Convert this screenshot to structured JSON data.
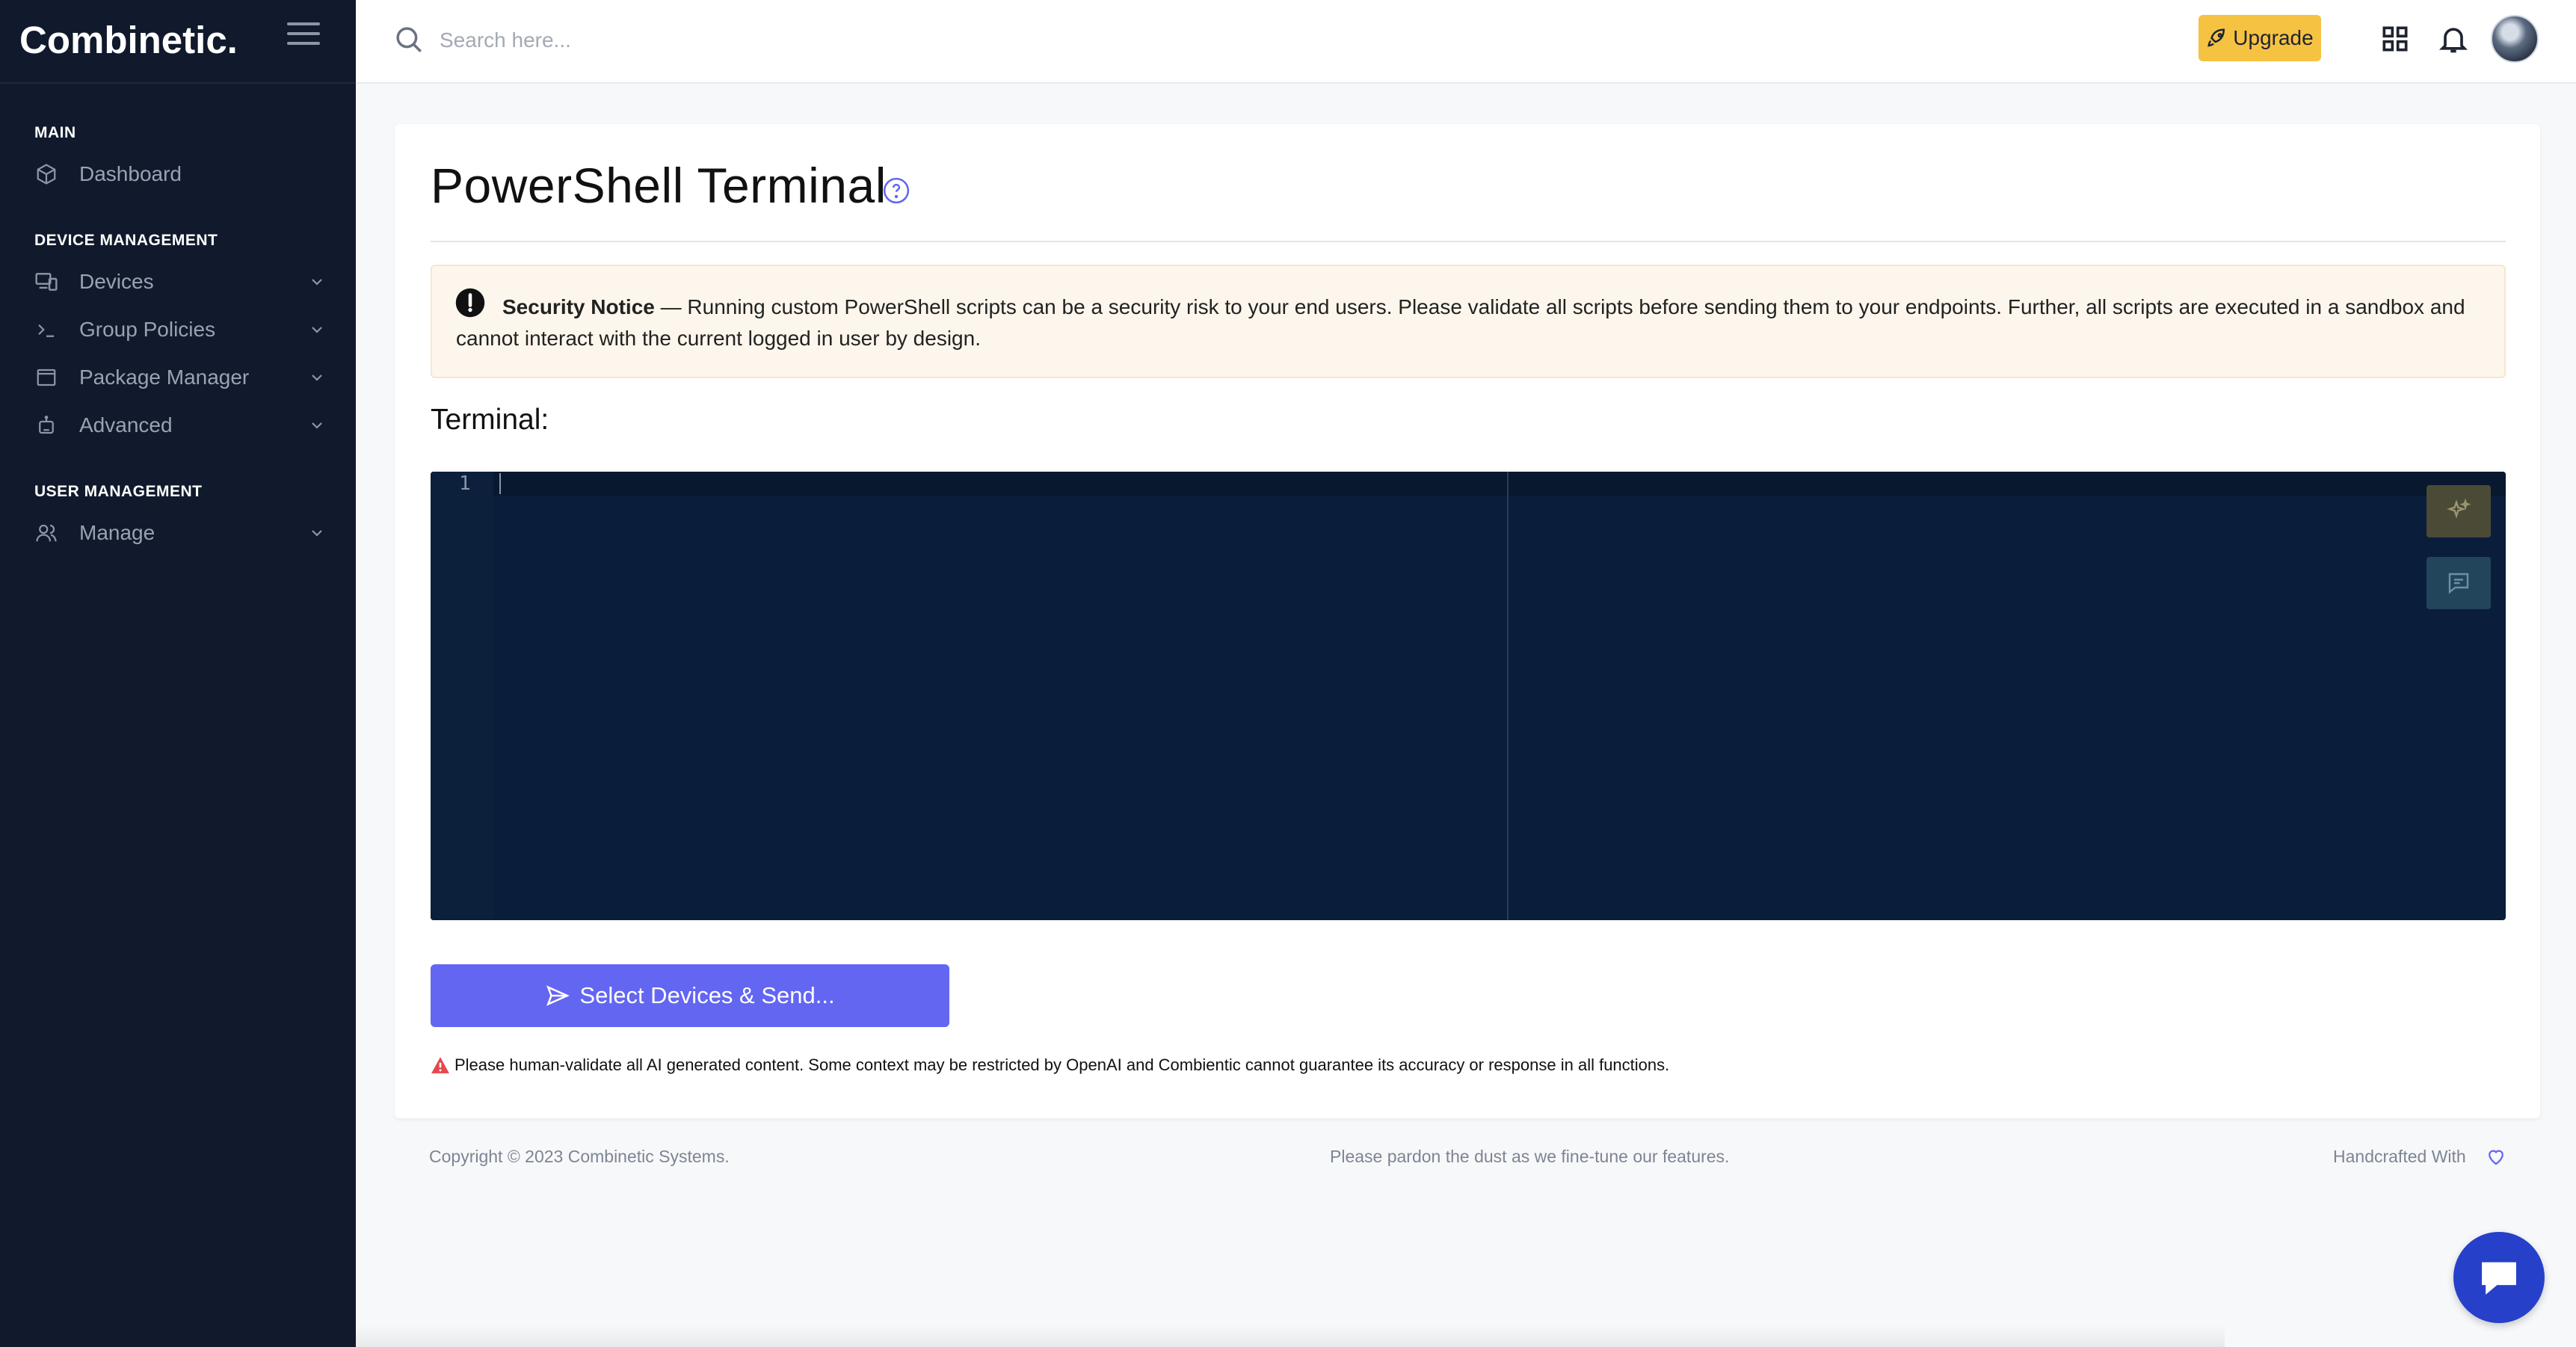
{
  "sidebar": {
    "brand": "Combinetic.",
    "sections": {
      "main": "MAIN",
      "device_management": "DEVICE MANAGEMENT",
      "user_management": "USER MANAGEMENT"
    },
    "items": [
      {
        "label": "Dashboard",
        "icon": "cube-icon"
      },
      {
        "label": "Devices",
        "icon": "devices-icon",
        "expandable": true
      },
      {
        "label": "Group Policies",
        "icon": "terminal-prompt-icon",
        "expandable": true
      },
      {
        "label": "Package Manager",
        "icon": "window-icon",
        "expandable": true
      },
      {
        "label": "Advanced",
        "icon": "robot-icon",
        "expandable": true
      },
      {
        "label": "Manage",
        "icon": "users-icon",
        "expandable": true
      }
    ]
  },
  "topbar": {
    "search_placeholder": "Search here...",
    "upgrade_label": "Upgrade",
    "icons": [
      "search-icon",
      "rocket-icon",
      "apps-grid-icon",
      "bell-icon",
      "avatar"
    ]
  },
  "main": {
    "title": "PowerShell Terminal",
    "notice": {
      "bold": "Security Notice",
      "text": " — Running custom PowerShell scripts can be a security risk to your end users. Please validate all scripts before sending them to your endpoints. Further, all scripts are executed in a sandbox and cannot interact with the current logged in user by design."
    },
    "terminal_label": "Terminal:",
    "editor": {
      "line_number": "1",
      "content": ""
    },
    "send_button": "Select Devices & Send...",
    "ai_warning": "Please human-validate all AI generated content. Some context may be restricted by OpenAI and Combientic cannot guarantee its accuracy or response in all functions."
  },
  "footer": {
    "copyright": "Copyright © 2023 Combinetic Systems.",
    "center": "Please pardon the dust as we fine-tune our features.",
    "right": "Handcrafted With"
  },
  "colors": {
    "sidebar_bg": "#111a2c",
    "accent": "#6366f1",
    "upgrade": "#f5c242",
    "editor_bg": "#0a1e3c",
    "notice_bg": "#fdf6ec"
  }
}
